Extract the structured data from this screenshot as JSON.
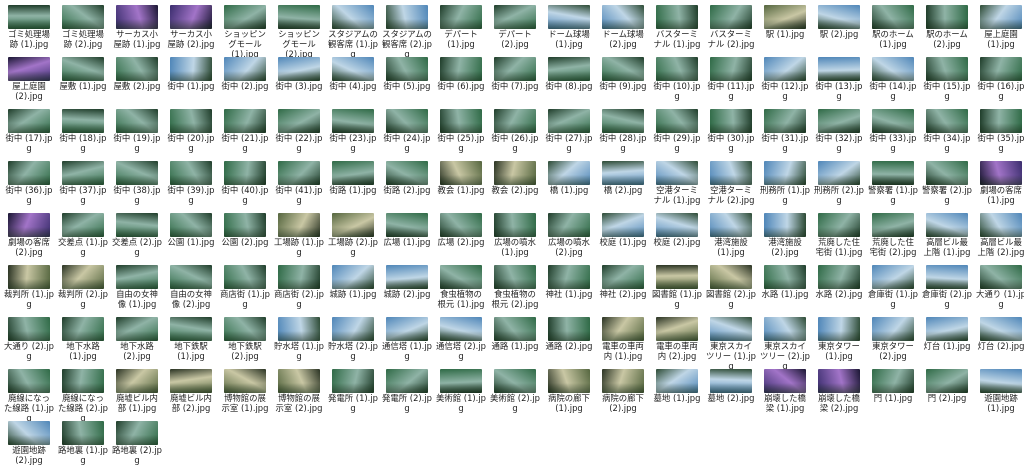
{
  "view": "large-icons",
  "thumbnail_palette": {
    "forest": [
      "#2f6a46",
      "#8fb3a6",
      "#1f3d2a"
    ],
    "night": [
      "#3b2e6e",
      "#a274c8",
      "#1a1633"
    ],
    "sky": [
      "#4f86b8",
      "#bfd6e6",
      "#2c4a34"
    ],
    "ruin": [
      "#55663f",
      "#c9c7a4",
      "#2a3323"
    ]
  },
  "files": [
    {
      "name": "ゴミ処理場跡 (1).jpg",
      "theme": "forest"
    },
    {
      "name": "ゴミ処理場跡 (2).jpg",
      "theme": "forest"
    },
    {
      "name": "サーカス小屋跡 (1).jpg",
      "theme": "night"
    },
    {
      "name": "サーカス小屋跡 (2).jpg",
      "theme": "night"
    },
    {
      "name": "ショッピングモール (1).jpg",
      "theme": "forest"
    },
    {
      "name": "ショッピングモール (2).jpg",
      "theme": "forest"
    },
    {
      "name": "スタジアムの観客席 (1).jpg",
      "theme": "sky"
    },
    {
      "name": "スタジアムの観客席 (2).jpg",
      "theme": "sky"
    },
    {
      "name": "デパート (1).jpg",
      "theme": "forest"
    },
    {
      "name": "デパート (2).jpg",
      "theme": "forest"
    },
    {
      "name": "ドーム球場 (1).jpg",
      "theme": "sky"
    },
    {
      "name": "ドーム球場 (2).jpg",
      "theme": "sky"
    },
    {
      "name": "バスターミナル (1).jpg",
      "theme": "forest"
    },
    {
      "name": "バスターミナル (2).jpg",
      "theme": "forest"
    },
    {
      "name": "駅 (1).jpg",
      "theme": "ruin"
    },
    {
      "name": "駅 (2).jpg",
      "theme": "sky"
    },
    {
      "name": "駅のホーム (1).jpg",
      "theme": "forest"
    },
    {
      "name": "駅のホーム (2).jpg",
      "theme": "forest"
    },
    {
      "name": "屋上庭園 (1).jpg",
      "theme": "sky"
    },
    {
      "name": "屋上庭園 (2).jpg",
      "theme": "night"
    },
    {
      "name": "屋敷 (1).jpg",
      "theme": "forest"
    },
    {
      "name": "屋敷 (2).jpg",
      "theme": "forest"
    },
    {
      "name": "街中 (1).jpg",
      "theme": "sky"
    },
    {
      "name": "街中 (2).jpg",
      "theme": "sky"
    },
    {
      "name": "街中 (3).jpg",
      "theme": "sky"
    },
    {
      "name": "街中 (4).jpg",
      "theme": "sky"
    },
    {
      "name": "街中 (5).jpg",
      "theme": "forest"
    },
    {
      "name": "街中 (6).jpg",
      "theme": "forest"
    },
    {
      "name": "街中 (7).jpg",
      "theme": "forest"
    },
    {
      "name": "街中 (8).jpg",
      "theme": "forest"
    },
    {
      "name": "街中 (9).jpg",
      "theme": "forest"
    },
    {
      "name": "街中 (10).jpg",
      "theme": "forest"
    },
    {
      "name": "街中 (11).jpg",
      "theme": "forest"
    },
    {
      "name": "街中 (12).jpg",
      "theme": "sky"
    },
    {
      "name": "街中 (13).jpg",
      "theme": "sky"
    },
    {
      "name": "街中 (14).jpg",
      "theme": "sky"
    },
    {
      "name": "街中 (15).jpg",
      "theme": "forest"
    },
    {
      "name": "街中 (16).jpg",
      "theme": "forest"
    },
    {
      "name": "街中 (17).jpg",
      "theme": "forest"
    },
    {
      "name": "街中 (18).jpg",
      "theme": "forest"
    },
    {
      "name": "街中 (19).jpg",
      "theme": "forest"
    },
    {
      "name": "街中 (20).jpg",
      "theme": "forest"
    },
    {
      "name": "街中 (21).jpg",
      "theme": "forest"
    },
    {
      "name": "街中 (22).jpg",
      "theme": "forest"
    },
    {
      "name": "街中 (23).jpg",
      "theme": "forest"
    },
    {
      "name": "街中 (24).jpg",
      "theme": "forest"
    },
    {
      "name": "街中 (25).jpg",
      "theme": "forest"
    },
    {
      "name": "街中 (26).jpg",
      "theme": "forest"
    },
    {
      "name": "街中 (27).jpg",
      "theme": "forest"
    },
    {
      "name": "街中 (28).jpg",
      "theme": "forest"
    },
    {
      "name": "街中 (29).jpg",
      "theme": "forest"
    },
    {
      "name": "街中 (30).jpg",
      "theme": "forest"
    },
    {
      "name": "街中 (31).jpg",
      "theme": "forest"
    },
    {
      "name": "街中 (32).jpg",
      "theme": "forest"
    },
    {
      "name": "街中 (33).jpg",
      "theme": "forest"
    },
    {
      "name": "街中 (34).jpg",
      "theme": "forest"
    },
    {
      "name": "街中 (35).jpg",
      "theme": "forest"
    },
    {
      "name": "街中 (36).jpg",
      "theme": "forest"
    },
    {
      "name": "街中 (37).jpg",
      "theme": "forest"
    },
    {
      "name": "街中 (38).jpg",
      "theme": "forest"
    },
    {
      "name": "街中 (39).jpg",
      "theme": "forest"
    },
    {
      "name": "街中 (40).jpg",
      "theme": "forest"
    },
    {
      "name": "街中 (41).jpg",
      "theme": "forest"
    },
    {
      "name": "街路 (1).jpg",
      "theme": "forest"
    },
    {
      "name": "街路 (2).jpg",
      "theme": "forest"
    },
    {
      "name": "教会 (1).jpg",
      "theme": "ruin"
    },
    {
      "name": "教会 (2).jpg",
      "theme": "ruin"
    },
    {
      "name": "橋 (1).jpg",
      "theme": "sky"
    },
    {
      "name": "橋 (2).jpg",
      "theme": "sky"
    },
    {
      "name": "空港ターミナル (1).jpg",
      "theme": "sky"
    },
    {
      "name": "空港ターミナル (2).jpg",
      "theme": "sky"
    },
    {
      "name": "刑務所 (1).jpg",
      "theme": "sky"
    },
    {
      "name": "刑務所 (2).jpg",
      "theme": "sky"
    },
    {
      "name": "警察署 (1).jpg",
      "theme": "forest"
    },
    {
      "name": "警察署 (2).jpg",
      "theme": "forest"
    },
    {
      "name": "劇場の客席 (1).jpg",
      "theme": "night"
    },
    {
      "name": "劇場の客席 (2).jpg",
      "theme": "night"
    },
    {
      "name": "交差点 (1).jpg",
      "theme": "forest"
    },
    {
      "name": "交差点 (2).jpg",
      "theme": "forest"
    },
    {
      "name": "公園 (1).jpg",
      "theme": "forest"
    },
    {
      "name": "公園 (2).jpg",
      "theme": "forest"
    },
    {
      "name": "工場跡 (1).jpg",
      "theme": "ruin"
    },
    {
      "name": "工場跡 (2).jpg",
      "theme": "ruin"
    },
    {
      "name": "広場 (1).jpg",
      "theme": "forest"
    },
    {
      "name": "広場 (2).jpg",
      "theme": "forest"
    },
    {
      "name": "広場の噴水 (1).jpg",
      "theme": "forest"
    },
    {
      "name": "広場の噴水 (2).jpg",
      "theme": "forest"
    },
    {
      "name": "校庭 (1).jpg",
      "theme": "sky"
    },
    {
      "name": "校庭 (2).jpg",
      "theme": "sky"
    },
    {
      "name": "港湾施設 (1).jpg",
      "theme": "sky"
    },
    {
      "name": "港湾施設 (2).jpg",
      "theme": "sky"
    },
    {
      "name": "荒廃した住宅街 (1).jpg",
      "theme": "forest"
    },
    {
      "name": "荒廃した住宅街 (2).jpg",
      "theme": "forest"
    },
    {
      "name": "高層ビル最上階 (1).jpg",
      "theme": "sky"
    },
    {
      "name": "高層ビル最上階 (2).jpg",
      "theme": "sky"
    },
    {
      "name": "裁判所 (1).jpg",
      "theme": "ruin"
    },
    {
      "name": "裁判所 (2).jpg",
      "theme": "ruin"
    },
    {
      "name": "自由の女神像 (1).jpg",
      "theme": "forest"
    },
    {
      "name": "自由の女神像 (2).jpg",
      "theme": "forest"
    },
    {
      "name": "商店街 (1).jpg",
      "theme": "forest"
    },
    {
      "name": "商店街 (2).jpg",
      "theme": "forest"
    },
    {
      "name": "城跡 (1).jpg",
      "theme": "sky"
    },
    {
      "name": "城跡 (2).jpg",
      "theme": "sky"
    },
    {
      "name": "食虫植物の根元 (1).jpg",
      "theme": "forest"
    },
    {
      "name": "食虫植物の根元 (2).jpg",
      "theme": "forest"
    },
    {
      "name": "神社 (1).jpg",
      "theme": "forest"
    },
    {
      "name": "神社 (2).jpg",
      "theme": "forest"
    },
    {
      "name": "図書館 (1).jpg",
      "theme": "ruin"
    },
    {
      "name": "図書館 (2).jpg",
      "theme": "ruin"
    },
    {
      "name": "水路 (1).jpg",
      "theme": "forest"
    },
    {
      "name": "水路 (2).jpg",
      "theme": "forest"
    },
    {
      "name": "倉庫街 (1).jpg",
      "theme": "sky"
    },
    {
      "name": "倉庫街 (2).jpg",
      "theme": "sky"
    },
    {
      "name": "大通り (1).jpg",
      "theme": "forest"
    },
    {
      "name": "大通り (2).jpg",
      "theme": "forest"
    },
    {
      "name": "地下水路 (1).jpg",
      "theme": "forest"
    },
    {
      "name": "地下水路 (2).jpg",
      "theme": "forest"
    },
    {
      "name": "地下鉄駅 (1).jpg",
      "theme": "forest"
    },
    {
      "name": "地下鉄駅 (2).jpg",
      "theme": "forest"
    },
    {
      "name": "貯水塔 (1).jpg",
      "theme": "sky"
    },
    {
      "name": "貯水塔 (2).jpg",
      "theme": "sky"
    },
    {
      "name": "通信塔 (1).jpg",
      "theme": "sky"
    },
    {
      "name": "通信塔 (2).jpg",
      "theme": "sky"
    },
    {
      "name": "通路 (1).jpg",
      "theme": "forest"
    },
    {
      "name": "通路 (2).jpg",
      "theme": "forest"
    },
    {
      "name": "電車の車両内 (1).jpg",
      "theme": "ruin"
    },
    {
      "name": "電車の車両内 (2).jpg",
      "theme": "ruin"
    },
    {
      "name": "東京スカイツリー (1).jpg",
      "theme": "sky"
    },
    {
      "name": "東京スカイツリー (2).jpg",
      "theme": "sky"
    },
    {
      "name": "東京タワー (1).jpg",
      "theme": "sky"
    },
    {
      "name": "東京タワー (2).jpg",
      "theme": "sky"
    },
    {
      "name": "灯台 (1).jpg",
      "theme": "sky"
    },
    {
      "name": "灯台 (2).jpg",
      "theme": "sky"
    },
    {
      "name": "廃線になった線路 (1).jpg",
      "theme": "forest"
    },
    {
      "name": "廃線になった線路 (2).jpg",
      "theme": "forest"
    },
    {
      "name": "廃墟ビル内部 (1).jpg",
      "theme": "ruin"
    },
    {
      "name": "廃墟ビル内部 (2).jpg",
      "theme": "ruin"
    },
    {
      "name": "博物館の展示室 (1).jpg",
      "theme": "ruin"
    },
    {
      "name": "博物館の展示室 (2).jpg",
      "theme": "ruin"
    },
    {
      "name": "発電所 (1).jpg",
      "theme": "forest"
    },
    {
      "name": "発電所 (2).jpg",
      "theme": "forest"
    },
    {
      "name": "美術館 (1).jpg",
      "theme": "forest"
    },
    {
      "name": "美術館 (2).jpg",
      "theme": "forest"
    },
    {
      "name": "病院の廊下 (1).jpg",
      "theme": "ruin"
    },
    {
      "name": "病院の廊下 (2).jpg",
      "theme": "ruin"
    },
    {
      "name": "墓地 (1).jpg",
      "theme": "sky"
    },
    {
      "name": "墓地 (2).jpg",
      "theme": "sky"
    },
    {
      "name": "崩壊した橋梁 (1).jpg",
      "theme": "night"
    },
    {
      "name": "崩壊した橋梁 (2).jpg",
      "theme": "night"
    },
    {
      "name": "門 (1).jpg",
      "theme": "forest"
    },
    {
      "name": "門 (2).jpg",
      "theme": "forest"
    },
    {
      "name": "遊園地跡 (1).jpg",
      "theme": "sky"
    },
    {
      "name": "遊園地跡 (2).jpg",
      "theme": "sky"
    },
    {
      "name": "路地裏 (1).jpg",
      "theme": "forest"
    },
    {
      "name": "路地裏 (2).jpg",
      "theme": "forest"
    }
  ]
}
